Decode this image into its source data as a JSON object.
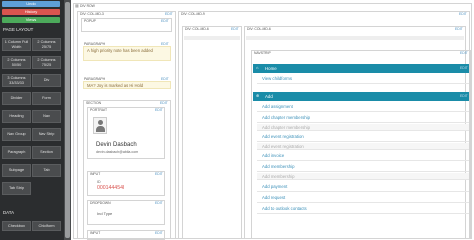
{
  "palette": {
    "undo": "Undo",
    "history": "History",
    "views": "Views",
    "page_layout_title": "PAGE LAYOUT",
    "data_title": "DATA",
    "buttons": [
      "1 Column Full Width",
      "2 Columns 25/75",
      "2 Columns 50/50",
      "2 Columns 75/25",
      "3 Columns 33/33/33",
      "Div",
      "Divider",
      "Form",
      "Heading",
      "Nav",
      "Nav Group",
      "Nav Strip",
      "Paragraph",
      "Section",
      "Subpage",
      "Tab",
      "Tab Strip"
    ],
    "data_buttons": [
      "Checkbox",
      "Chiclform"
    ]
  },
  "canvas": {
    "div_row": "DIV ROW",
    "col_md_3": "DIV: COL-MD-3",
    "col_md_9": "DIV: COL-MD-9",
    "popup": "POPUP",
    "paragraph_1": "PARAGRAPH",
    "warn_1": "A high priority note has been added",
    "paragraph_2": "PARAGRAPH",
    "warn_2": "MA? Joy is marked as Hi Hold",
    "section": "SECTION",
    "portrait": "PORTRAIT",
    "person_name": "Devin Dasbach",
    "person_email": "devin.dasbach@abila.com",
    "input_1": "INPUT",
    "id_label": "ID",
    "id_value": "000144454I",
    "dropdown": "DROPDOWN",
    "ind_type_label": "Ind Type",
    "input_2": "INPUT",
    "col_md_6a": "DIV: COL-MD-6",
    "col_md_6b": "DIV: COL-MD-6",
    "navstrip": "NAVSTRIP",
    "edit": "EDIT",
    "home_label": "Home",
    "view_childforms": "View childforms",
    "add_label": "Add",
    "menu_items": [
      {
        "label": "Add assignment",
        "enabled": true
      },
      {
        "label": "Add chapter membership",
        "enabled": true
      },
      {
        "label": "Add chapter membership",
        "enabled": false
      },
      {
        "label": "Add event registration",
        "enabled": true
      },
      {
        "label": "Add event registration",
        "enabled": false
      },
      {
        "label": "Add invoice",
        "enabled": true
      },
      {
        "label": "Add membership",
        "enabled": true
      },
      {
        "label": "Add membership",
        "enabled": false
      },
      {
        "label": "Add payment",
        "enabled": true
      },
      {
        "label": "Add request",
        "enabled": true
      },
      {
        "label": "Add to outlook contacts",
        "enabled": true
      }
    ]
  },
  "colors": {
    "navstrip_head": "#1a8ca8",
    "link": "#3a8fb8",
    "id_value": "#d9534f"
  }
}
